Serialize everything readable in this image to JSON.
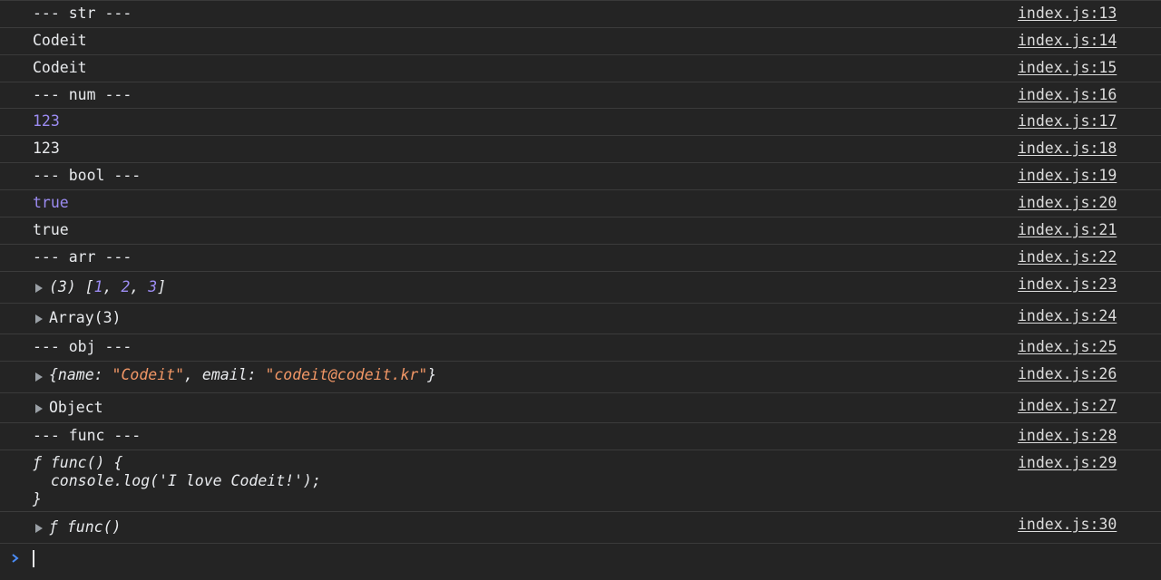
{
  "console": {
    "rows": [
      {
        "text": "--- str ---",
        "link": "index.js:13"
      },
      {
        "text": "Codeit",
        "link": "index.js:14"
      },
      {
        "text": "Codeit",
        "link": "index.js:15"
      },
      {
        "text": "--- num ---",
        "link": "index.js:16"
      },
      {
        "text": "123",
        "link": "index.js:17"
      },
      {
        "text": "123",
        "link": "index.js:18"
      },
      {
        "text": "--- bool ---",
        "link": "index.js:19"
      },
      {
        "text": "true",
        "link": "index.js:20"
      },
      {
        "text": "true",
        "link": "index.js:21"
      },
      {
        "text": "--- arr ---",
        "link": "index.js:22"
      },
      {
        "link": "index.js:23",
        "parts": [
          "(3) [",
          "1",
          ", ",
          "2",
          ", ",
          "3",
          "]"
        ]
      },
      {
        "text": "Array(3)",
        "link": "index.js:24"
      },
      {
        "text": "--- obj ---",
        "link": "index.js:25"
      },
      {
        "link": "index.js:26",
        "parts": [
          "{name: ",
          "\"Codeit\"",
          ", email: ",
          "\"codeit@codeit.kr\"",
          "}"
        ]
      },
      {
        "text": "Object",
        "link": "index.js:27"
      },
      {
        "text": "--- func ---",
        "link": "index.js:28"
      },
      {
        "link": "index.js:29",
        "lines": [
          "ƒ func() {",
          "  console.log('I love Codeit!');",
          "}"
        ]
      },
      {
        "text": "ƒ func()",
        "link": "index.js:30"
      }
    ]
  },
  "colors": {
    "background": "#242424",
    "number": "#9c8cf2",
    "string": "#f29766",
    "prompt": "#4a8cf7"
  },
  "icons": {
    "expand": "triangle-right-icon",
    "prompt": "chevron-right-icon"
  }
}
